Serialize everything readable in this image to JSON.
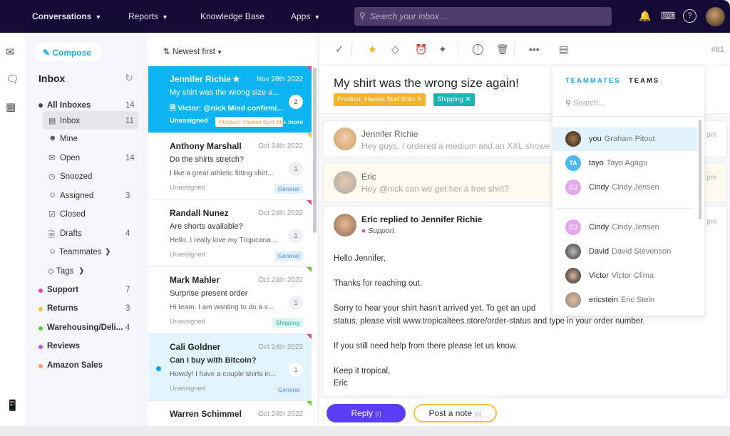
{
  "topnav": {
    "items": [
      "Conversations",
      "Reports",
      "Knowledge Base",
      "Apps"
    ],
    "search_placeholder": "Search your inbox…",
    "icons": [
      "bell-icon",
      "keyboard-icon",
      "help-icon"
    ]
  },
  "sidebar": {
    "compose": "Compose",
    "title": "Inbox",
    "items": [
      {
        "label": "All Inboxes",
        "count": "14"
      },
      {
        "label": "Inbox",
        "count": "11"
      },
      {
        "label": "Mine",
        "count": ""
      },
      {
        "label": "Open",
        "count": "14"
      },
      {
        "label": "Snoozed",
        "count": ""
      },
      {
        "label": "Assigned",
        "count": "3"
      },
      {
        "label": "Closed",
        "count": ""
      },
      {
        "label": "Drafts",
        "count": "4"
      },
      {
        "label": "Teammates",
        "count": ""
      },
      {
        "label": "Tags",
        "count": ""
      }
    ],
    "tags": [
      {
        "label": "Support",
        "count": "7",
        "color": "#f0409a"
      },
      {
        "label": "Returns",
        "count": "3",
        "color": "#f8c22e"
      },
      {
        "label": "Warehousing/Deli...",
        "count": "4",
        "color": "#5ed12f"
      },
      {
        "label": "Reviews",
        "count": "",
        "color": "#b05ad8"
      },
      {
        "label": "Amazon Sales",
        "count": "",
        "color": "#fb9b64"
      }
    ]
  },
  "list": {
    "sort": "Newest first",
    "items": [
      {
        "name": "Jennifer Richie",
        "date": "Nov 28th 2022",
        "subject": "My shirt was the wrong size a...",
        "preview": "Victor: @nick Mind confirmi...",
        "assignee": "Unassigned",
        "badge": "2",
        "tag": "Product: Hawaii Surf Sh",
        "more": "+ more"
      },
      {
        "name": "Anthony Marshall",
        "date": "Oct 24th 2022",
        "subject": "Do the shirts stretch?",
        "preview": "I like a great athletic fitting shirt...",
        "assignee": "Unassigned",
        "badge": "1",
        "tag": "General"
      },
      {
        "name": "Randall Nunez",
        "date": "Oct 24th 2022",
        "subject": "Are shorts available?",
        "preview": "Hello. I really love my Tropicana...",
        "assignee": "Unassigned",
        "badge": "1",
        "tag": "General"
      },
      {
        "name": "Mark Mahler",
        "date": "Oct 24th 2022",
        "subject": "Surprise present order",
        "preview": "Hi team, I am wanting to do a s...",
        "assignee": "Unassigned",
        "badge": "1",
        "tag": "Shipping"
      },
      {
        "name": "Cali Goldner",
        "date": "Oct 24th 2022",
        "subject": "Can I buy with Bitcoin?",
        "preview": "Howdy! I have a couple shirts in...",
        "assignee": "Unassigned",
        "badge": "1",
        "tag": "General"
      },
      {
        "name": "Warren Schimmel",
        "date": "Oct 24th 2022"
      }
    ]
  },
  "conversation": {
    "number": "#81",
    "subject": "My shirt was the wrong size again!",
    "tags": [
      "Product: Hawaii Surf Shirt",
      "Shipping"
    ],
    "messages": [
      {
        "from": "Jennifer Richie",
        "preview": "Hey guys, I ordered a medium and an XXL showe",
        "time": "pm"
      },
      {
        "from": "Eric",
        "preview": "Hey @nick can we get her a free shirt?",
        "time": "pm"
      },
      {
        "from": "Eric replied to Jennifer Richie",
        "inbox": "Support",
        "time": "pm"
      }
    ],
    "body": [
      "Hello Jennifer,",
      "Thanks for reaching out.",
      "Sorry to hear your shirt hasn't arrived yet.  To get an upd",
      "status, please visit www.tropicaltees.store/order-status and type in your order number.",
      "If you still need help from there please let us know.",
      "Keep it tropical,",
      "Eric"
    ],
    "reply": "Reply",
    "reply_key": "[r]",
    "note": "Post a note",
    "note_key": "[n]"
  },
  "assign_dropdown": {
    "tabs": [
      "TEAMMATES",
      "TEAMS"
    ],
    "search_placeholder": "Search...",
    "teammates": [
      {
        "user": "you",
        "name": "Graham Pitout"
      },
      {
        "user": "tayo",
        "name": "Tayo Agagu",
        "initials": "TA"
      },
      {
        "user": "Cindy",
        "name": "Cindy Jensen",
        "initials": "CJ"
      },
      {
        "user": "Cindy",
        "name": "Cindy Jensen",
        "initials": "CJ"
      },
      {
        "user": "David",
        "name": "David Stevenson"
      },
      {
        "user": "Victor",
        "name": "Victor Clima"
      },
      {
        "user": "ericstein",
        "name": "Eric Stein"
      }
    ]
  }
}
